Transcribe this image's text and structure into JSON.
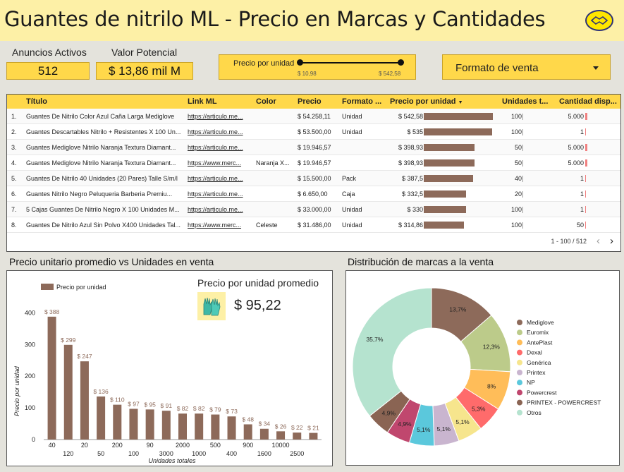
{
  "header": {
    "title": "Guantes de nitrilo ML - Precio en Marcas y Cantidades"
  },
  "kpis": {
    "anuncios_label": "Anuncios Activos",
    "anuncios_value": "512",
    "valor_label": "Valor Potencial",
    "valor_value": "$ 13,86 mil M"
  },
  "slider": {
    "title": "Precio por unidad",
    "min": "$ 10,98",
    "max": "$ 542,58"
  },
  "dropdown": {
    "label": "Formato de venta"
  },
  "table": {
    "headers": [
      "Título",
      "Link ML",
      "Color",
      "Precio",
      "Formato ...",
      "Precio por unidad",
      "Unidades t...",
      "Cantidad disp..."
    ],
    "rows": [
      {
        "n": "1.",
        "titulo": "Guantes De Nitrilo Color Azul Caña Larga Mediglove",
        "link": "https://articulo.me...",
        "color": "",
        "precio": "$ 54.258,11",
        "formato": "Unidad",
        "pu": "$ 542,58",
        "pu_val": 542.58,
        "unidades": "100",
        "cd": "5.000",
        "cd_val": 5000
      },
      {
        "n": "2.",
        "titulo": "Guantes Descartables Nitrilo + Resistentes X 100 Un...",
        "link": "https://articulo.me...",
        "color": "",
        "precio": "$ 53.500,00",
        "formato": "Unidad",
        "pu": "$ 535",
        "pu_val": 535,
        "unidades": "100",
        "cd": "1",
        "cd_val": 1
      },
      {
        "n": "3.",
        "titulo": "Guantes Mediglove Nitrilo Naranja Textura Diamant...",
        "link": "https://articulo.me...",
        "color": "",
        "precio": "$ 19.946,57",
        "formato": "",
        "pu": "$ 398,93",
        "pu_val": 398.93,
        "unidades": "50",
        "cd": "5.000",
        "cd_val": 5000
      },
      {
        "n": "4.",
        "titulo": "Guantes Mediglove Nitrilo Naranja Textura Diamant...",
        "link": "https://www.merc...",
        "color": "Naranja X...",
        "precio": "$ 19.946,57",
        "formato": "",
        "pu": "$ 398,93",
        "pu_val": 398.93,
        "unidades": "50",
        "cd": "5.000",
        "cd_val": 5000
      },
      {
        "n": "5.",
        "titulo": "Guantes De Nitrilo 40 Unidades (20 Pares) Talle S/m/l",
        "link": "https://articulo.me...",
        "color": "",
        "precio": "$ 15.500,00",
        "formato": "Pack",
        "pu": "$ 387,5",
        "pu_val": 387.5,
        "unidades": "40",
        "cd": "1",
        "cd_val": 1
      },
      {
        "n": "6.",
        "titulo": "Guantes Nitrilo Negro Peluqueria Barberia Premiu...",
        "link": "https://articulo.me...",
        "color": "",
        "precio": "$ 6.650,00",
        "formato": "Caja",
        "pu": "$ 332,5",
        "pu_val": 332.5,
        "unidades": "20",
        "cd": "1",
        "cd_val": 1
      },
      {
        "n": "7.",
        "titulo": "5 Cajas Guantes De Nitrilo Negro X 100 Unidades M...",
        "link": "https://articulo.me...",
        "color": "",
        "precio": "$ 33.000,00",
        "formato": "Unidad",
        "pu": "$ 330",
        "pu_val": 330,
        "unidades": "100",
        "cd": "1",
        "cd_val": 1
      },
      {
        "n": "8.",
        "titulo": "Guantes De Nitrilo Azul Sin Polvo X400 Unidades Tal...",
        "link": "https://www.merc...",
        "color": "Celeste",
        "precio": "$ 31.486,00",
        "formato": "Unidad",
        "pu": "$ 314,86",
        "pu_val": 314.86,
        "unidades": "100",
        "cd": "50",
        "cd_val": 50
      }
    ],
    "pager": "1 - 100 / 512",
    "pu_max": 542.58
  },
  "bar_section": {
    "title": "Precio unitario promedio vs Unidades en venta",
    "kpi_label": "Precio por unidad promedio",
    "kpi_value": "$ 95,22"
  },
  "pie_section": {
    "title": "Distribución de marcas a la venta"
  },
  "colors": {
    "bar": "#8d6a5a",
    "accent": "#ffd84a",
    "cd_bar": "#f08080"
  },
  "chart_data": [
    {
      "type": "bar",
      "title": "",
      "legend": [
        "Precio por unidad"
      ],
      "xlabel": "Unidades totales",
      "ylabel": "Precio por unidad",
      "ylim": [
        0,
        430
      ],
      "yticks": [
        0,
        100,
        200,
        300,
        400
      ],
      "categories": [
        "40",
        "120",
        "20",
        "50",
        "200",
        "100",
        "90",
        "3000",
        "2000",
        "1000",
        "500",
        "400",
        "900",
        "1600",
        "10000",
        "2500"
      ],
      "values": [
        388,
        299,
        247,
        136,
        110,
        97,
        95,
        91,
        82,
        82,
        79,
        73,
        48,
        34,
        26,
        22,
        21
      ],
      "labels": [
        "$ 388",
        "$ 299",
        "$ 247",
        "$ 136",
        "$ 110",
        "$ 97",
        "$ 95",
        "$ 91",
        "$ 82",
        "$ 82",
        "$ 79",
        "$ 73",
        "$ 48",
        "$ 34",
        "$ 26",
        "$ 22",
        "$ 21"
      ]
    },
    {
      "type": "pie",
      "title": "",
      "legend_position": "right",
      "slices": [
        {
          "name": "Mediglove",
          "value": 13.7,
          "label": "13,7%",
          "color": "#8d6a5a"
        },
        {
          "name": "Euromix",
          "value": 12.3,
          "label": "12,3%",
          "color": "#bccb8a"
        },
        {
          "name": "AntePlast",
          "value": 8,
          "label": "8%",
          "color": "#ffbd59"
        },
        {
          "name": "Dexal",
          "value": 5.3,
          "label": "5,3%",
          "color": "#ff6b6b"
        },
        {
          "name": "Genérica",
          "value": 5.1,
          "label": "5,1%",
          "color": "#f6e58d"
        },
        {
          "name": "Printex",
          "value": 5.1,
          "label": "5,1%",
          "color": "#c9b5cf"
        },
        {
          "name": "NP",
          "value": 5.1,
          "label": "5,1%",
          "color": "#5bc8dc"
        },
        {
          "name": "Powercrest",
          "value": 4.9,
          "label": "4,9%",
          "color": "#c0476e"
        },
        {
          "name": "PRINTEX - POWERCREST",
          "value": 4.9,
          "label": "4,9%",
          "color": "#8a6453"
        },
        {
          "name": "Otros",
          "value": 35.7,
          "label": "35,7%",
          "color": "#b5e3cf"
        }
      ]
    }
  ]
}
